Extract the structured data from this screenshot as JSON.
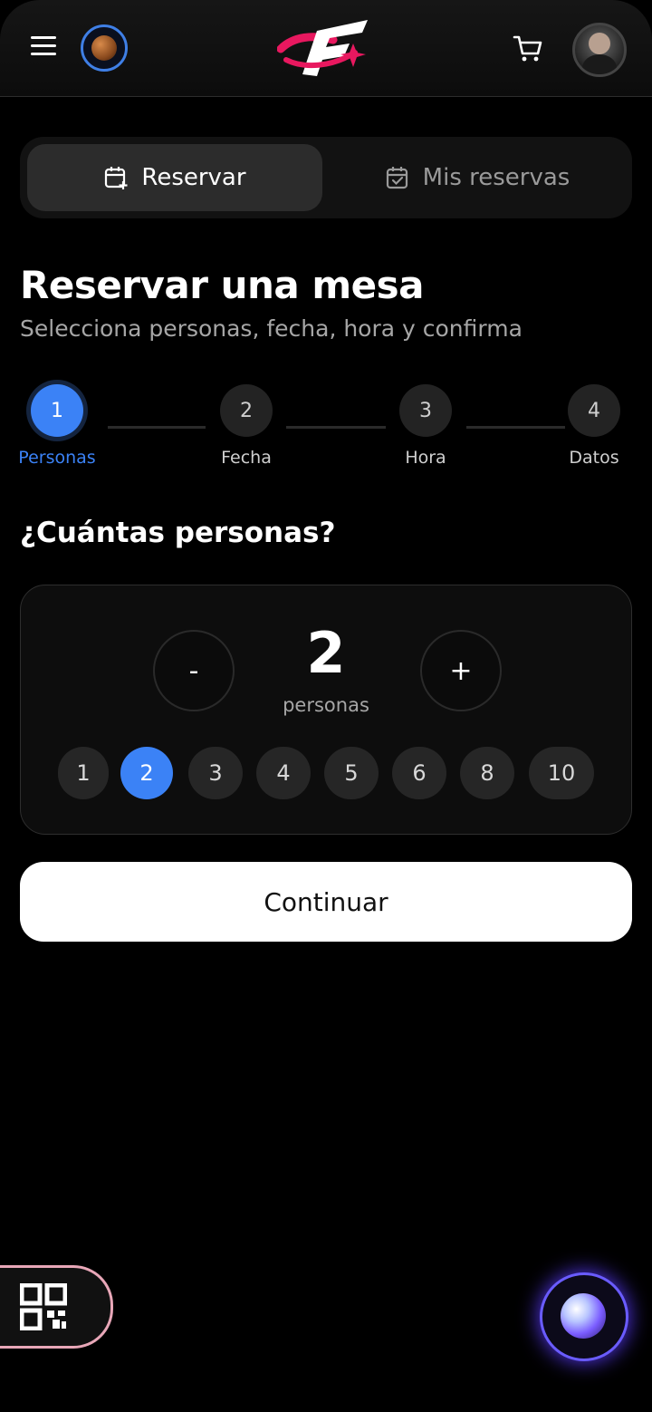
{
  "header": {
    "menu_icon": "hamburger-menu-icon",
    "planet_icon": "planet-icon",
    "logo": "app-logo",
    "cart_icon": "cart-icon",
    "avatar": "user-avatar"
  },
  "tabs": [
    {
      "label": "Reservar",
      "icon": "calendar-plus-icon",
      "active": true
    },
    {
      "label": "Mis reservas",
      "icon": "calendar-check-icon",
      "active": false
    }
  ],
  "page": {
    "title": "Reservar una mesa",
    "subtitle": "Selecciona personas, fecha, hora y confirma"
  },
  "steps": [
    {
      "number": "1",
      "label": "Personas",
      "active": true
    },
    {
      "number": "2",
      "label": "Fecha",
      "active": false
    },
    {
      "number": "3",
      "label": "Hora",
      "active": false
    },
    {
      "number": "4",
      "label": "Datos",
      "active": false
    }
  ],
  "people": {
    "question": "¿Cuántas personas?",
    "decrement_label": "-",
    "increment_label": "+",
    "count": "2",
    "unit": "personas",
    "options": [
      "1",
      "2",
      "3",
      "4",
      "5",
      "6",
      "8",
      "10"
    ],
    "selected": "2"
  },
  "actions": {
    "continue_label": "Continuar"
  },
  "colors": {
    "accent": "#3b82f6",
    "background": "#000000",
    "qr_border": "#e8a7b8",
    "orb_glow": "#6a5cff"
  }
}
